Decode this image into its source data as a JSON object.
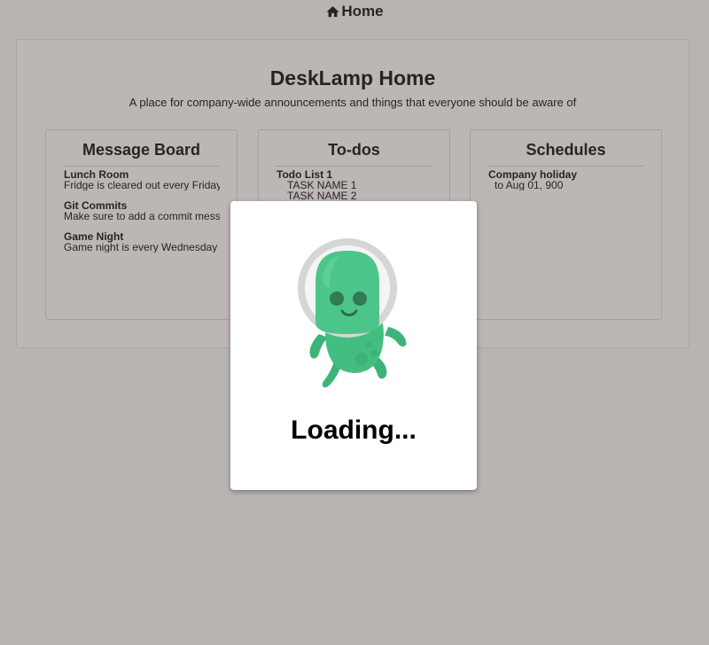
{
  "topnav": {
    "icon": "home-icon",
    "label": "Home"
  },
  "page": {
    "title": "DeskLamp Home",
    "subtitle": "A place for company-wide announcements and things that everyone should be aware of"
  },
  "message_board": {
    "title": "Message Board",
    "items": [
      {
        "title": "Lunch Room",
        "text": "Fridge is cleared out every Friday"
      },
      {
        "title": "Git Commits",
        "text": "Make sure to add a commit message"
      },
      {
        "title": "Game Night",
        "text": "Game night is every Wednesday after work"
      }
    ]
  },
  "todos": {
    "title": "To-dos",
    "list_title": "Todo List 1",
    "tasks": [
      "TASK NAME 1",
      "TASK NAME 2"
    ]
  },
  "schedules": {
    "title": "Schedules",
    "items": [
      {
        "title": "Company holiday",
        "text": "to Aug 01, 900"
      }
    ]
  },
  "loading": {
    "text": "Loading...",
    "icon": "astronaut-mascot-icon",
    "colors": {
      "mascot": "#4cc58a",
      "helmet": "#d6d6d6",
      "backdrop": "#bcb7b4"
    }
  }
}
